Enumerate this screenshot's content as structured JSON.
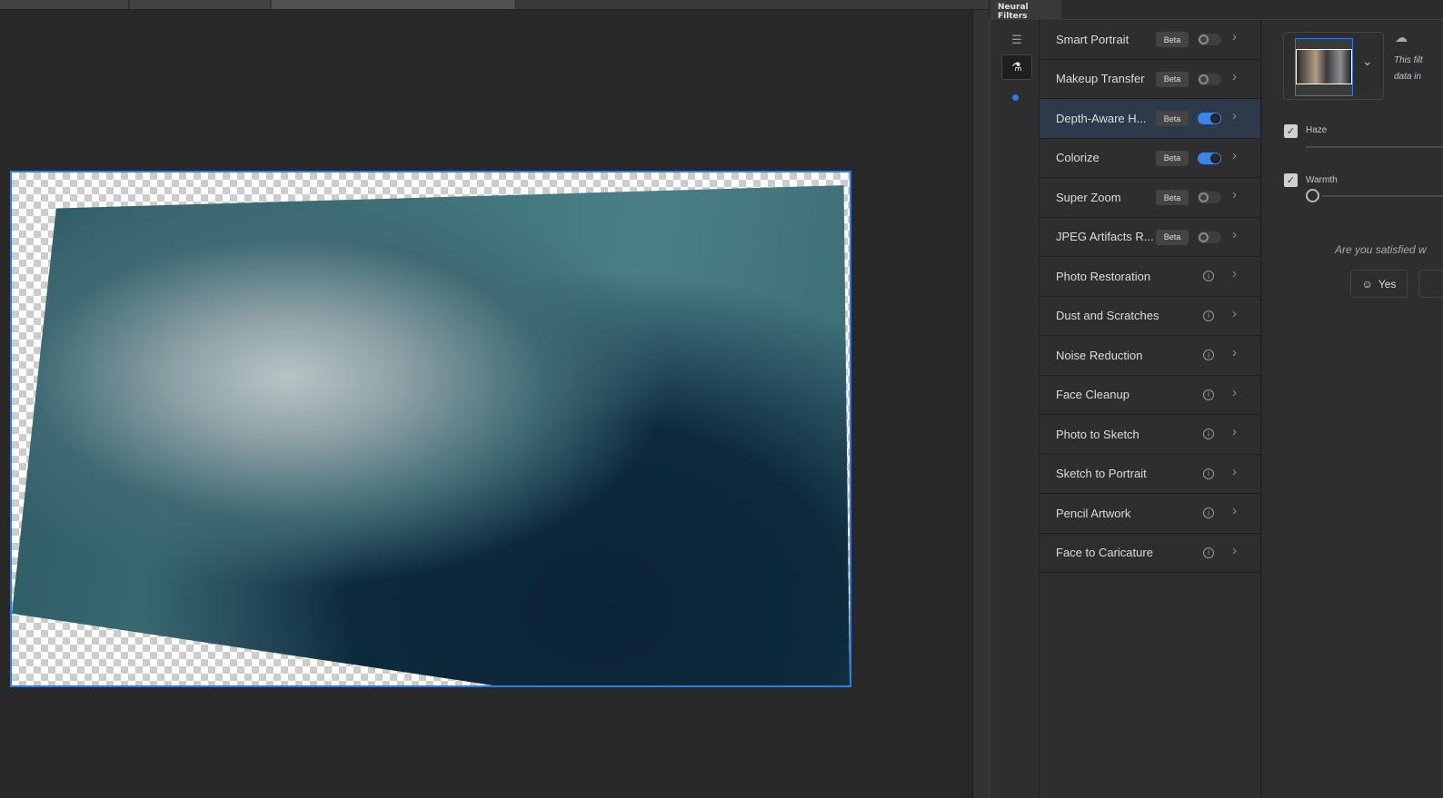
{
  "panel": {
    "tab_label": "Neural Filters"
  },
  "filters": [
    {
      "label": "Smart Portrait",
      "badge": "Beta",
      "toggle": false
    },
    {
      "label": "Makeup Transfer",
      "badge": "Beta",
      "toggle": false
    },
    {
      "label": "Depth-Aware H...",
      "badge": "Beta",
      "toggle": true,
      "selected": true
    },
    {
      "label": "Colorize",
      "badge": "Beta",
      "toggle": true
    },
    {
      "label": "Super Zoom",
      "badge": "Beta",
      "toggle": false
    },
    {
      "label": "JPEG Artifacts R...",
      "badge": "Beta",
      "toggle": false
    },
    {
      "label": "Photo Restoration"
    },
    {
      "label": "Dust and Scratches"
    },
    {
      "label": "Noise Reduction"
    },
    {
      "label": "Face Cleanup"
    },
    {
      "label": "Photo to Sketch"
    },
    {
      "label": "Sketch to Portrait"
    },
    {
      "label": "Pencil Artwork"
    },
    {
      "label": "Face to Caricature"
    }
  ],
  "settings": {
    "cloud_note_line1": "This filt",
    "cloud_note_line2": "data in",
    "haze": {
      "label": "Haze",
      "checked": true
    },
    "warmth": {
      "label": "Warmth",
      "checked": true,
      "value_fraction": 0
    },
    "feedback_question": "Are you satisfied w",
    "yes_label": "Yes"
  },
  "colors": {
    "accent": "#2d7be5",
    "selected_row": "#2c3a4b"
  }
}
